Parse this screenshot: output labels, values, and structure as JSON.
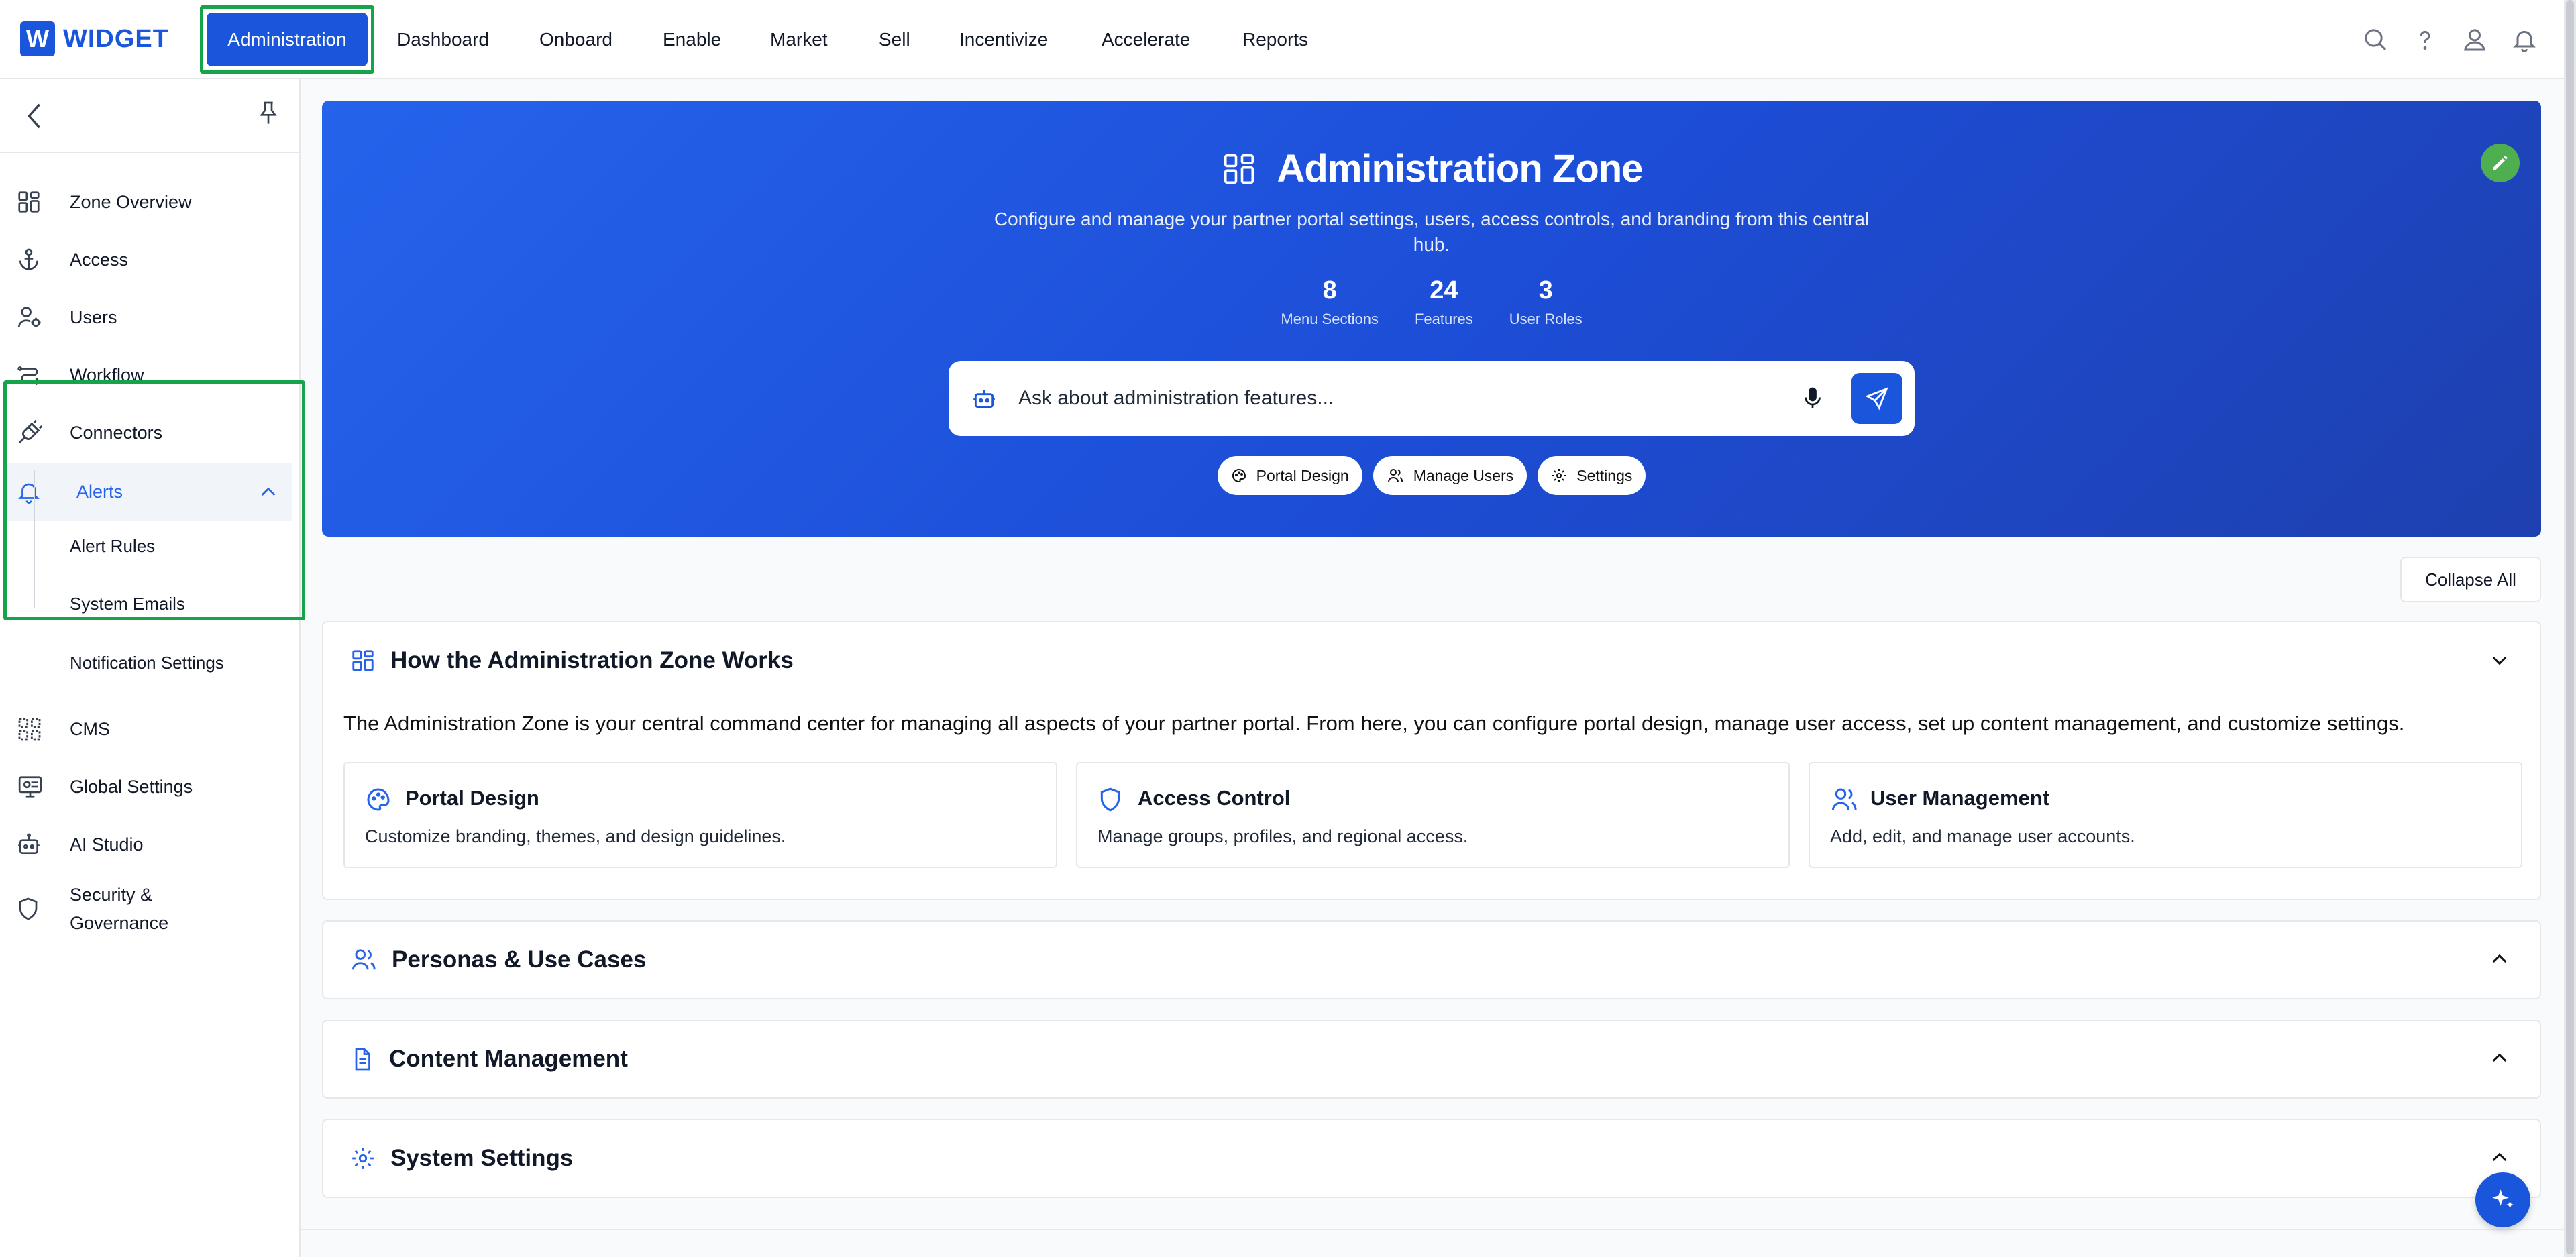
{
  "brand": {
    "badge": "W",
    "name": "WIDGET"
  },
  "nav": {
    "active": "Administration",
    "items": [
      "Dashboard",
      "Onboard",
      "Enable",
      "Market",
      "Sell",
      "Incentivize",
      "Accelerate",
      "Reports"
    ]
  },
  "top_icons": [
    "search-icon",
    "help-icon",
    "user-icon",
    "bell-icon"
  ],
  "sidebar": {
    "items": [
      {
        "label": "Zone Overview",
        "icon": "grid-icon"
      },
      {
        "label": "Access",
        "icon": "anchor-icon"
      },
      {
        "label": "Users",
        "icon": "user-gear-icon"
      },
      {
        "label": "Workflow",
        "icon": "workflow-icon"
      },
      {
        "label": "Connectors",
        "icon": "plug-icon"
      },
      {
        "label": "Alerts",
        "icon": "bell-icon"
      },
      {
        "label": "CMS",
        "icon": "cms-icon"
      },
      {
        "label": "Global Settings",
        "icon": "monitor-settings-icon"
      },
      {
        "label": "AI Studio",
        "icon": "robot-icon"
      },
      {
        "label": "Security &",
        "label2": "Governance",
        "icon": "shield-icon"
      }
    ],
    "alerts_sub": [
      "Alert Rules",
      "System Emails",
      "Notification Settings"
    ]
  },
  "hero": {
    "title": "Administration Zone",
    "description": "Configure and manage your partner portal settings, users, access controls, and branding from this central hub.",
    "stats": [
      {
        "value": "8",
        "label": "Menu Sections"
      },
      {
        "value": "24",
        "label": "Features"
      },
      {
        "value": "3",
        "label": "User Roles"
      }
    ],
    "search_placeholder": "Ask about administration features...",
    "chips": [
      "Portal Design",
      "Manage Users",
      "Settings"
    ]
  },
  "collapse_all": "Collapse All",
  "sections": {
    "how": {
      "title": "How the Administration Zone Works",
      "intro": "The Administration Zone is your central command center for managing all aspects of your partner portal. From here, you can configure portal design, manage user access, set up content management, and customize settings.",
      "cards": [
        {
          "title": "Portal Design",
          "desc": "Customize branding, themes, and design guidelines."
        },
        {
          "title": "Access Control",
          "desc": "Manage groups, profiles, and regional access."
        },
        {
          "title": "User Management",
          "desc": "Add, edit, and manage user accounts."
        }
      ]
    },
    "personas": {
      "title": "Personas & Use Cases"
    },
    "content": {
      "title": "Content Management"
    },
    "system": {
      "title": "System Settings"
    }
  },
  "colors": {
    "accent": "#1a56db",
    "highlight": "#16a34a",
    "hero_gradient_start": "#2563eb",
    "hero_gradient_end": "#1e40af"
  }
}
